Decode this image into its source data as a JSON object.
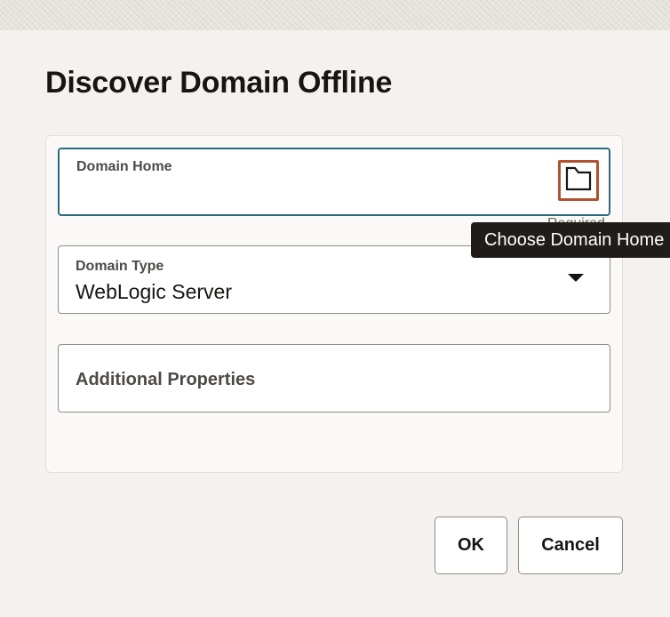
{
  "dialog": {
    "title": "Discover Domain Offline"
  },
  "fields": {
    "domain_home": {
      "label": "Domain Home",
      "value": "",
      "browse_icon": "folder-icon",
      "required_text": "Required",
      "tooltip": "Choose Domain Home"
    },
    "domain_type": {
      "label": "Domain Type",
      "value": "WebLogic Server",
      "dropdown_icon": "caret-down-icon"
    },
    "additional_properties": {
      "label": "Additional Properties",
      "value": ""
    }
  },
  "footer": {
    "ok_label": "OK",
    "cancel_label": "Cancel"
  },
  "colors": {
    "focus_border": "#2b6a7e",
    "highlight_border": "#b35030",
    "tooltip_bg": "#1f1c1a",
    "dialog_bg": "#f4f1ee"
  }
}
